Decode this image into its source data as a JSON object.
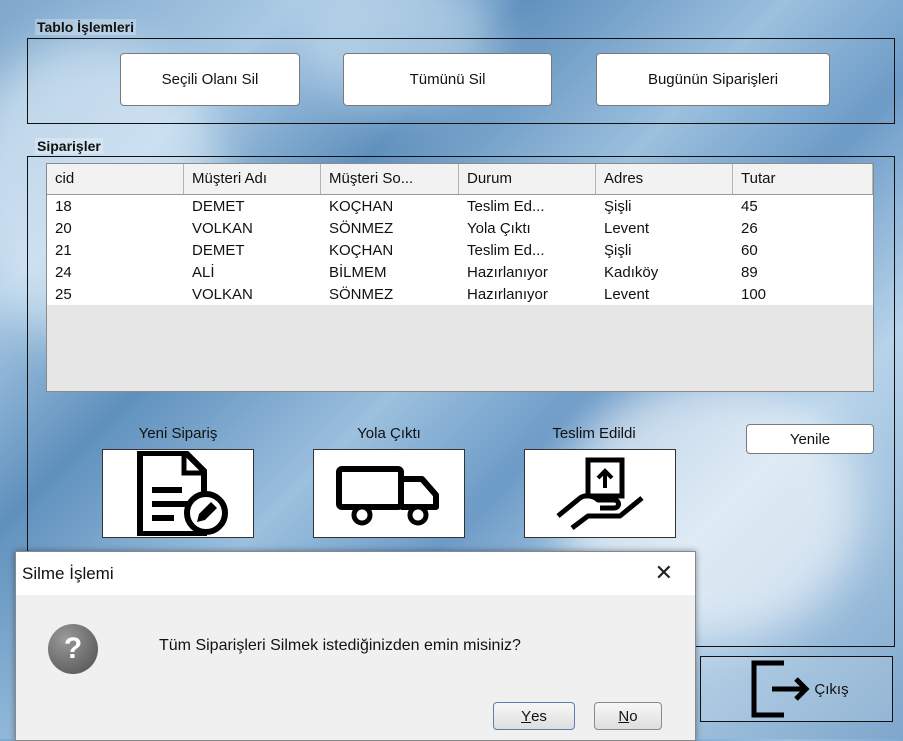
{
  "sections": {
    "table_ops_title": "Tablo İşlemleri",
    "orders_title": "Siparişler"
  },
  "toolbar": {
    "delete_selected": "Seçili Olanı Sil",
    "delete_all": "Tümünü Sil",
    "today_orders": "Bugünün Siparişleri"
  },
  "table": {
    "columns": [
      "cid",
      "Müşteri Adı",
      "Müşteri So...",
      "Durum",
      "Adres",
      "Tutar"
    ],
    "rows": [
      [
        "18",
        "DEMET",
        "KOÇHAN",
        "Teslim Ed...",
        "Şişli",
        "45"
      ],
      [
        "20",
        "VOLKAN",
        "SÖNMEZ",
        "Yola Çıktı",
        "Levent",
        "26"
      ],
      [
        "21",
        "DEMET",
        "KOÇHAN",
        "Teslim Ed...",
        "Şişli",
        "60"
      ],
      [
        "24",
        "ALİ",
        "BİLMEM",
        "Hazırlanıyor",
        "Kadıköy",
        "89"
      ],
      [
        "25",
        "VOLKAN",
        "SÖNMEZ",
        "Hazırlanıyor",
        "Levent",
        "100"
      ]
    ]
  },
  "actions": {
    "new_order": "Yeni Sipariş",
    "on_the_way": "Yola Çıktı",
    "delivered": "Teslim Edildi",
    "refresh": "Yenile",
    "exit": "Çıkış"
  },
  "dialog": {
    "title": "Silme İşlemi",
    "message": "Tüm Siparişleri Silmek istediğinizden emin misiniz?",
    "yes_mnemonic": "Y",
    "yes_rest": "es",
    "no_mnemonic": "N",
    "no_rest": "o",
    "close_glyph": "✕",
    "icon": "question-icon"
  }
}
